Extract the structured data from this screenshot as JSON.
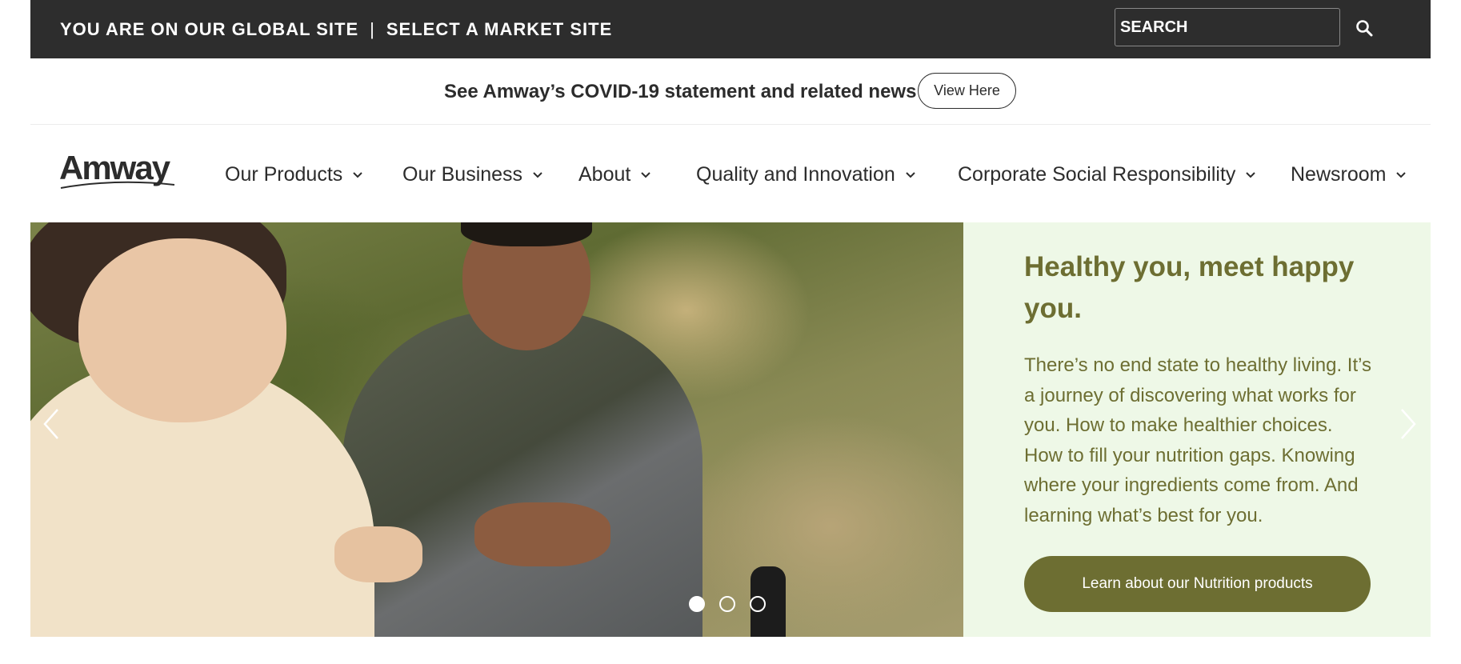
{
  "topbar": {
    "global_site": "YOU ARE ON OUR GLOBAL SITE",
    "separator": "|",
    "market_site": "SELECT A MARKET SITE",
    "search_value": "SEARCH"
  },
  "covid": {
    "statement": "See Amway’s COVID-19 statement and related news",
    "button": "View Here"
  },
  "nav": {
    "logo": "Amway",
    "items": [
      {
        "label": "Our Products"
      },
      {
        "label": "Our Business"
      },
      {
        "label": "About"
      },
      {
        "label": "Quality and Innovation"
      },
      {
        "label": "Corporate Social Responsibility"
      },
      {
        "label": "Newsroom"
      }
    ]
  },
  "hero": {
    "headline": "Healthy you, meet happy you.",
    "body": "There’s no end state to healthy living. It’s a journey of discovering what works for you. How to make healthier choices. How to fill your nutrition gaps. Knowing where your ingredients come from. And learning what’s best for you.",
    "cta": "Learn about our Nutrition products",
    "slides_total": 3,
    "active_slide": 1
  },
  "icons": {
    "search": "search-icon",
    "chevron": "chevron-down-icon",
    "prev": "chevron-left-icon",
    "next": "chevron-right-icon"
  },
  "colors": {
    "topbar_bg": "#2d2d2d",
    "accent_olive": "#6d6e32",
    "promo_bg": "#eef8e7"
  }
}
